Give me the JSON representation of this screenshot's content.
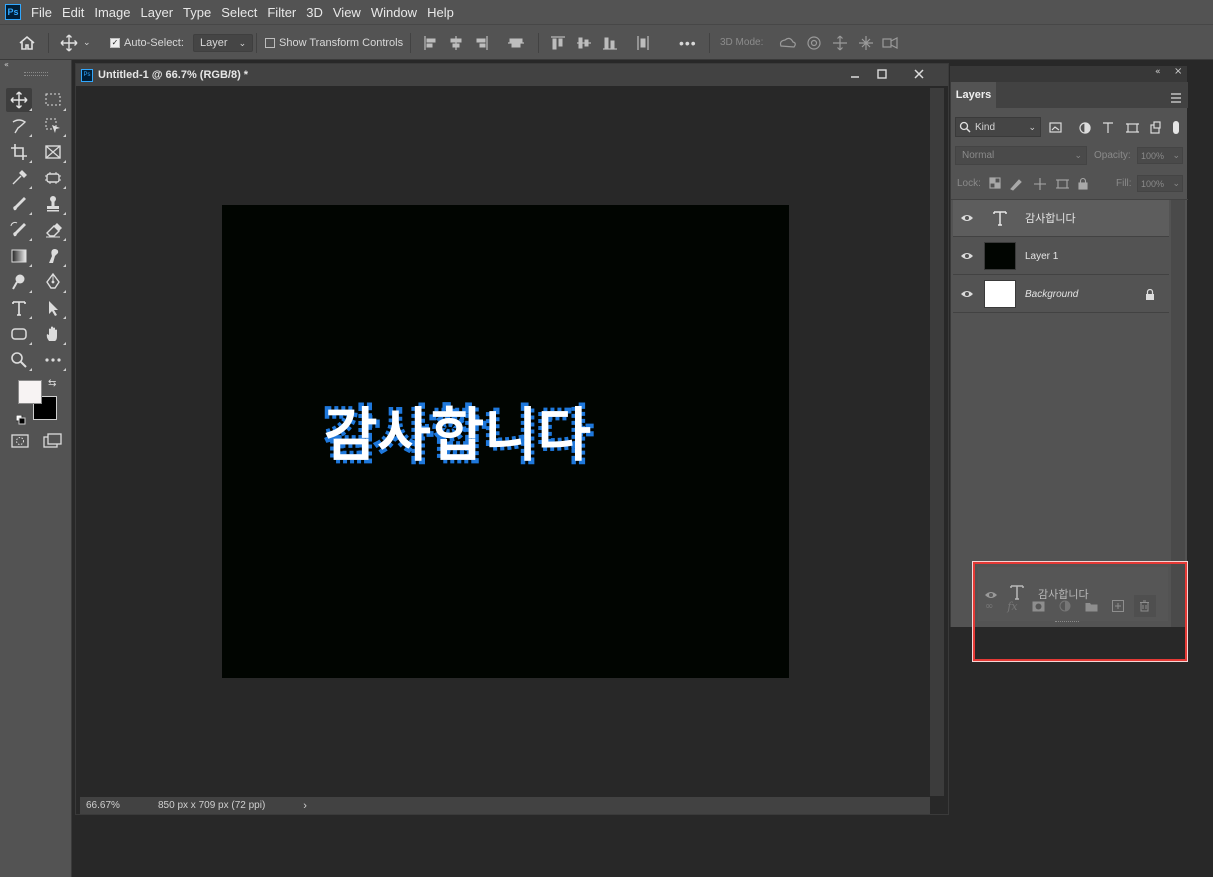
{
  "app": {
    "logo": "Ps"
  },
  "menu": [
    "File",
    "Edit",
    "Image",
    "Layer",
    "Type",
    "Select",
    "Filter",
    "3D",
    "View",
    "Window",
    "Help"
  ],
  "options_bar": {
    "auto_select_label": "Auto-Select:",
    "auto_select_checked": true,
    "auto_select_value": "Layer",
    "show_transform_label": "Show Transform Controls",
    "show_transform_checked": false,
    "more_label": "•••",
    "mode_3d_label": "3D Mode:"
  },
  "document": {
    "title": "Untitled-1 @ 66.7% (RGB/8) *",
    "zoom": "66.67%",
    "dimensions": "850 px x 709 px (72 ppi)",
    "canvas_text": "감사합니다",
    "canvas_bg": "#010501",
    "text_fill": "#ffffff",
    "text_stroke": "#1e78dc"
  },
  "layers_panel": {
    "tab": "Layers",
    "filter_kind": "Kind",
    "blend_mode": "Normal",
    "opacity_label": "Opacity:",
    "opacity_value": "100%",
    "lock_label": "Lock:",
    "fill_label": "Fill:",
    "fill_value": "100%",
    "layers": [
      {
        "name": "감사합니다",
        "type": "text",
        "selected": true
      },
      {
        "name": "Layer 1",
        "type": "fill",
        "thumb_color": "#010501"
      },
      {
        "name": "Background",
        "type": "background",
        "thumb_color": "#ffffff",
        "locked": true
      }
    ],
    "drag_ghost_label": "감사합니다"
  }
}
